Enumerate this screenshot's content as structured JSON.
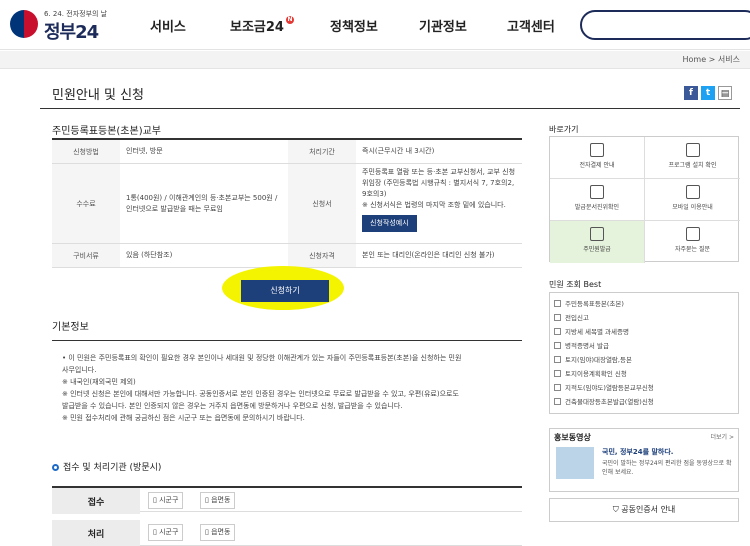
{
  "header": {
    "tagline": "6. 24. 전자정부의 날",
    "logo": "정부24",
    "nav": [
      "서비스",
      "보조금24",
      "정책정보",
      "기관정보",
      "고객센터"
    ],
    "nav_badge": "N"
  },
  "breadcrumb": {
    "home": "Home",
    "sep": ">",
    "current": "서비스"
  },
  "page": {
    "title": "민원안내 및 신청"
  },
  "share": {
    "facebook": "f",
    "twitter": "t",
    "print": "▤"
  },
  "service": {
    "name": "주민등록표등본(초본)교부",
    "rows": [
      {
        "h1": "신청방법",
        "v1": "인터넷, 방문",
        "h2": "처리기간",
        "v2": "즉시(근무시간 내 3시간)"
      },
      {
        "h1": "수수료",
        "v1": "1통(400원) / 이해관계인의 등·초본교부는 500원 / 인터넷으로 발급받을 때는 무료임",
        "h2": "신청서",
        "v2": "주민등록표 열람 또는 등·초본 교부신청서, 교부 신청 위임장 (주민등록법 시행규칙 : 별지서식 7, 7호의2, 9호의3)",
        "v2_note": "※ 신청서식은 법령의 마지막 조항 밑에 있습니다.",
        "v2_button": "신청작성예시"
      },
      {
        "h1": "구비서류",
        "v1": "있음 (하단참조)",
        "h2": "신청자격",
        "v2": "본인 또는 대리인(온라인은 대리인 신청 불가)"
      }
    ],
    "apply_button": "신청하기"
  },
  "basic": {
    "title": "기본정보",
    "lines": [
      "• 이 민원은 주민등록표의 확인이 필요한 경우 본인이나 세대원 및 정당한 이해관계가 있는 자들이 주민등록표등본(초본)을 신청하는 민원",
      "  사무입니다.",
      "※ 내국인(재외국민 제외)",
      "※ 인터넷 신청은 본인에 대해서만 가능합니다. 공동인증서로 본인 인증된 경우는 인터넷으로 무료로 발급받을 수 있고, 우편(유료)으로도",
      "발급받을 수 있습니다. 본인 인증되지 않은 경우는 거주지 읍면동에 방문하거나 우편으로 신청, 발급받을 수 있습니다.",
      "※ 민원 접수처리에 관해 궁금하신 점은 시군구 또는 읍면동에 문의하시기 바랍니다."
    ]
  },
  "office": {
    "title": "접수 및 처리기관 (방문시)",
    "rows": [
      {
        "label": "접수",
        "chips": [
          "시군구",
          "읍면동"
        ]
      },
      {
        "label": "처리",
        "chips": [
          "시군구",
          "읍면동"
        ]
      }
    ]
  },
  "sidebar": {
    "quick_title": "바로가기",
    "quick": [
      "전자결제 안내",
      "프로그램 설치 확인",
      "발급문서진위확인",
      "모바일 이용안내",
      "주민원발급",
      "자주묻는 질문"
    ],
    "best_title": "민원 조회 Best",
    "best": [
      "주민등록표등본(초본)",
      "전입신고",
      "지방세 세목별 과세증명",
      "병적증명서 발급",
      "토지(임야)대장열람,등본",
      "토지이용계획확인 신청",
      "지적도(임야도)열람등본교부신청",
      "건축물대장등초본발급(열람)신청"
    ],
    "video_title": "홍보동영상",
    "video_more": "더보기 >",
    "video_caption": "국민, 정부24를 말하다.",
    "video_desc": "국민이 말하는 정부24의 편리한 점을 동영상으로 확인해 보세요.",
    "cert": "공동인증서 안내"
  }
}
